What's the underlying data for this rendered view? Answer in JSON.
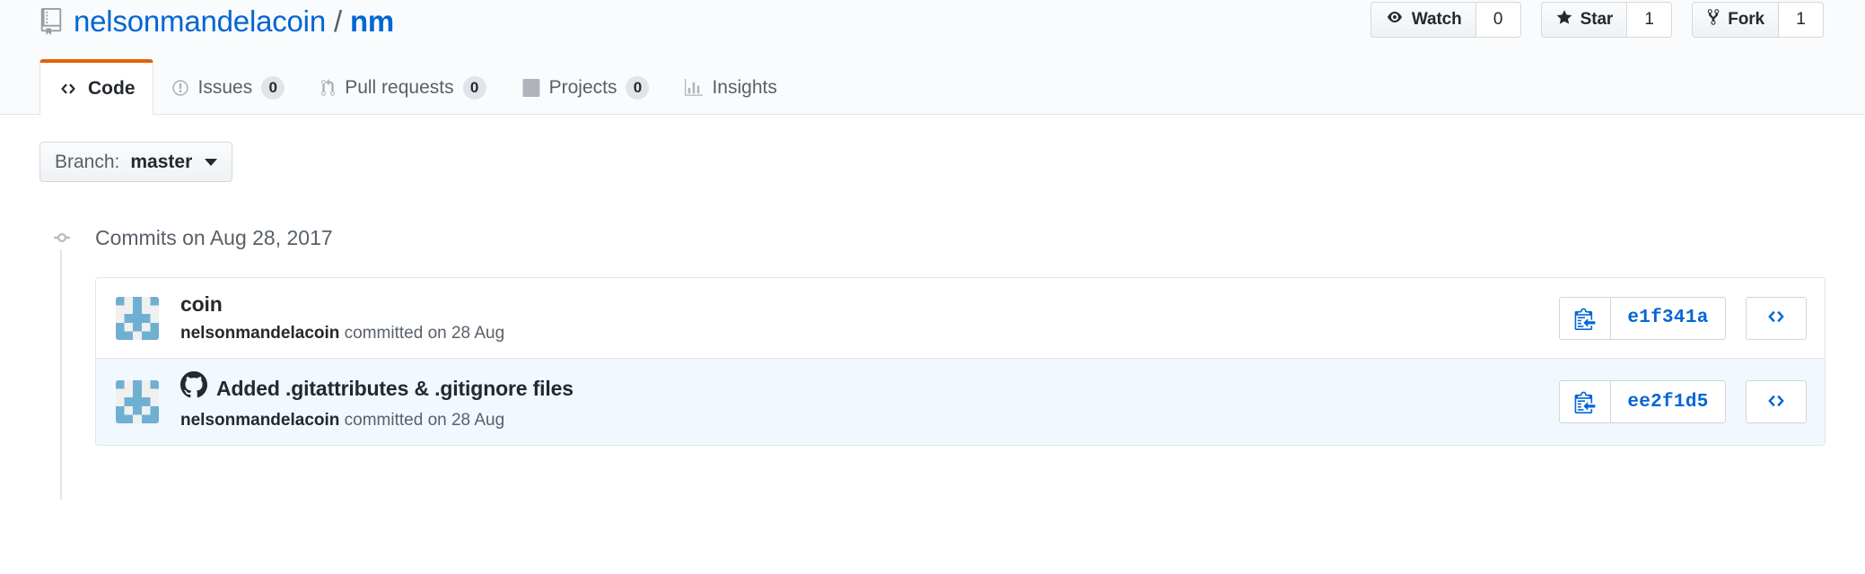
{
  "repo": {
    "icon": "repo-icon",
    "owner": "nelsonmandelacoin",
    "separator": "/",
    "name": "nm"
  },
  "actions": [
    {
      "label": "Watch",
      "count": "0",
      "icon": "eye-icon"
    },
    {
      "label": "Star",
      "count": "1",
      "icon": "star-icon"
    },
    {
      "label": "Fork",
      "count": "1",
      "icon": "repo-forked-icon"
    }
  ],
  "tabs": [
    {
      "label": "Code",
      "count": "",
      "icon": "code-icon",
      "active": true
    },
    {
      "label": "Issues",
      "count": "0",
      "icon": "issue-opened-icon",
      "active": false
    },
    {
      "label": "Pull requests",
      "count": "0",
      "icon": "git-pull-request-icon",
      "active": false
    },
    {
      "label": "Projects",
      "count": "0",
      "icon": "project-icon",
      "active": false
    },
    {
      "label": "Insights",
      "count": "",
      "icon": "graph-icon",
      "active": false
    }
  ],
  "branch": {
    "prefix": "Branch:",
    "name": "master",
    "caret": "chevron-down-icon"
  },
  "commits": {
    "group_title": "Commits on Aug 28, 2017",
    "node_icon": "commit-node-icon",
    "rows": [
      {
        "avatar": "identicon-avatar",
        "message": "coin",
        "has_octocat": false,
        "author": "nelsonmandelacoin",
        "meta_suffix": "committed on 28 Aug",
        "sha": "e1f341a",
        "copy_icon": "clipboard-copy-icon",
        "browse_icon": "code-icon",
        "highlight": false
      },
      {
        "avatar": "identicon-avatar",
        "message": "Added .gitattributes & .gitignore files",
        "has_octocat": true,
        "octocat_icon": "octocat-icon",
        "author": "nelsonmandelacoin",
        "meta_suffix": "committed on 28 Aug",
        "sha": "ee2f1d5",
        "copy_icon": "clipboard-copy-icon",
        "browse_icon": "code-icon",
        "highlight": true
      }
    ]
  },
  "colors": {
    "link": "#0366d6",
    "active_tab_border": "#e36209",
    "text": "#24292e",
    "muted": "#586069",
    "border": "#e1e4e8",
    "highlight_bg": "#f1f8ff",
    "identicon": "#6fb0d2"
  }
}
